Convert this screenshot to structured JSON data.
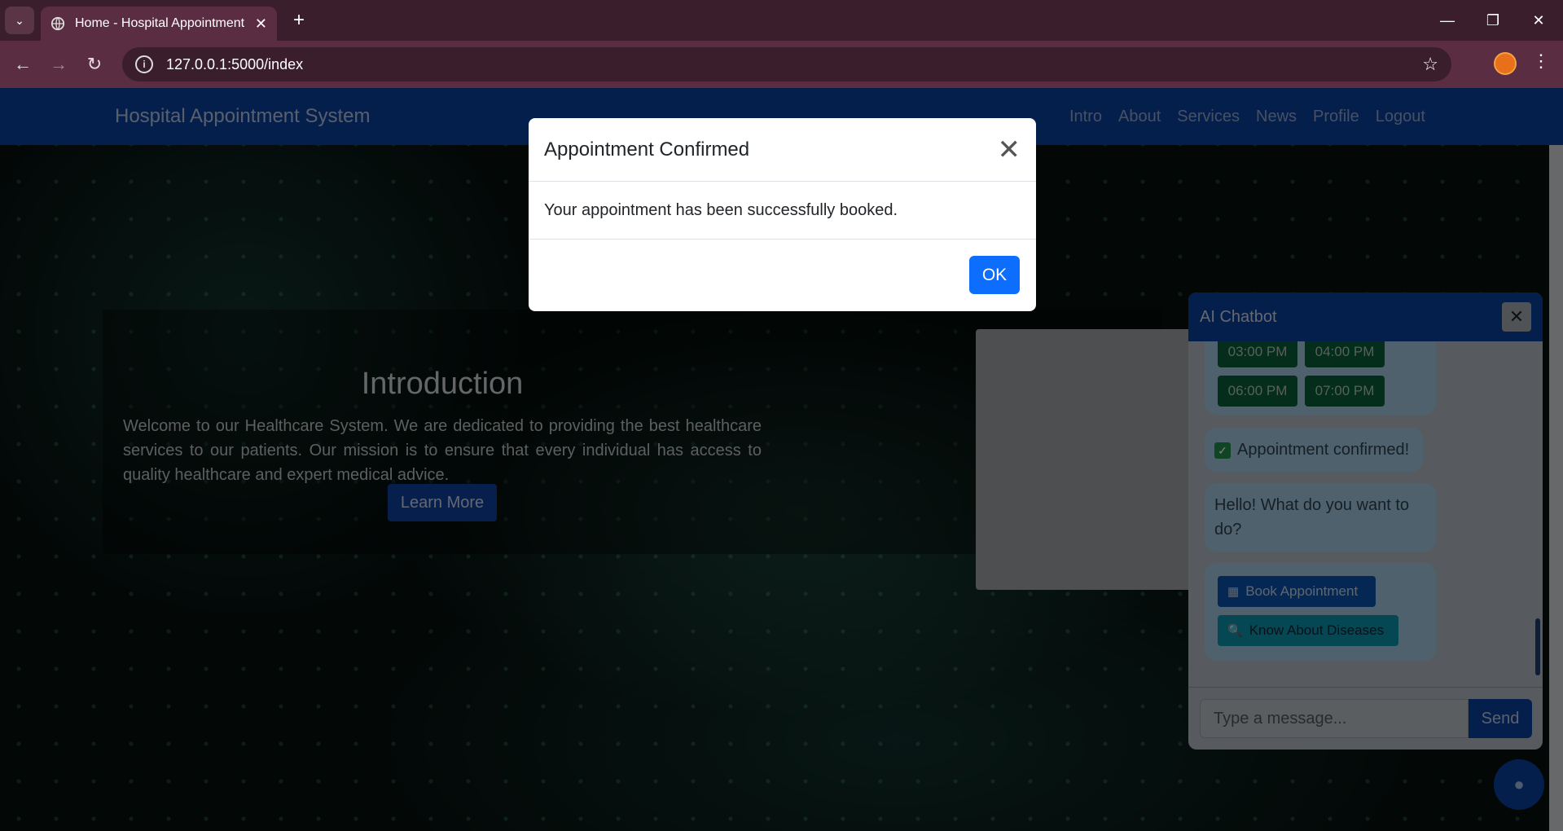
{
  "browser": {
    "tab_title": "Home - Hospital Appointment S",
    "tab_close": "✕",
    "new_tab": "+",
    "url": "127.0.0.1:5000/index",
    "window_controls": {
      "minimize": "—",
      "restore": "❐",
      "close": "✕"
    }
  },
  "site": {
    "brand": "Hospital Appointment System",
    "nav": [
      "Intro",
      "About",
      "Services",
      "News",
      "Profile",
      "Logout"
    ]
  },
  "intro": {
    "title": "Introduction",
    "text": "Welcome to our Healthcare System. We are dedicated to providing the best healthcare services to our patients. Our mission is to ensure that every individual has access to quality healthcare and expert medical advice.",
    "button": "Learn More"
  },
  "modal": {
    "title": "Appointment Confirmed",
    "close": "✕",
    "message": "Your appointment has been successfully booked.",
    "ok": "OK"
  },
  "chatbot": {
    "title": "AI Chatbot",
    "close": "✕",
    "slots": [
      "03:00 PM",
      "04:00 PM",
      "06:00 PM",
      "07:00 PM"
    ],
    "confirmed": "Appointment confirmed!",
    "greeting": "Hello! What do you want to do?",
    "options": {
      "book": "Book Appointment",
      "diseases": "Know About Diseases"
    },
    "input_placeholder": "Type a message...",
    "send": "Send"
  },
  "icons": [
    "chevron-down-icon",
    "globe-icon",
    "back-icon",
    "forward-icon",
    "reload-icon",
    "info-icon",
    "star-icon",
    "profile-icon",
    "kebab-menu-icon",
    "checkbox-icon",
    "calendar-icon",
    "magnifier-icon",
    "chat-bubble-icon"
  ]
}
